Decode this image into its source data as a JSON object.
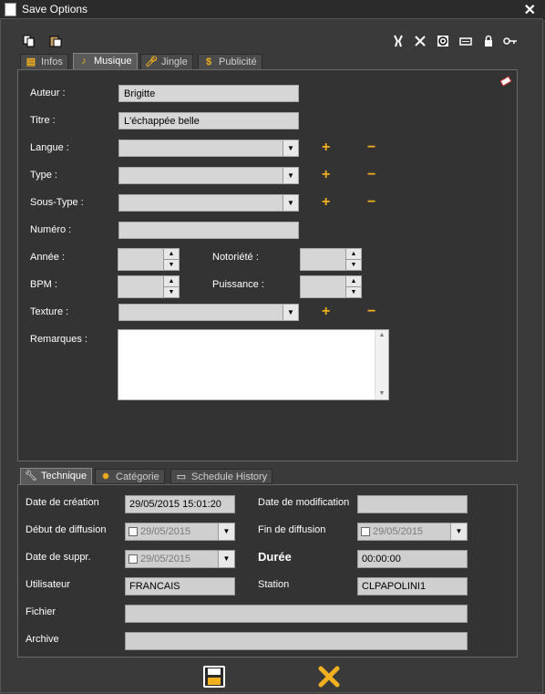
{
  "window": {
    "title": "Save Options"
  },
  "toolbar": {
    "left_icons": [
      "copy-icon",
      "paste-icon"
    ],
    "right_icons": [
      "pliers-icon",
      "tools-icon",
      "target-icon",
      "card-icon",
      "lock-icon",
      "key-icon"
    ]
  },
  "top_tabs": [
    {
      "label": "Infos",
      "icon": "notepad-icon",
      "active": false
    },
    {
      "label": "Musique",
      "icon": "music-note-icon",
      "active": true
    },
    {
      "label": "Jingle",
      "icon": "microphone-icon",
      "active": false
    },
    {
      "label": "Publicité",
      "icon": "dollar-icon",
      "active": false
    }
  ],
  "musique": {
    "auteur_label": "Auteur :",
    "auteur_value": "Brigitte",
    "titre_label": "Titre :",
    "titre_value": "L'échappée belle",
    "langue_label": "Langue :",
    "type_label": "Type :",
    "soustype_label": "Sous-Type :",
    "numero_label": "Numéro :",
    "annee_label": "Année :",
    "notoriete_label": "Notoriété :",
    "bpm_label": "BPM :",
    "puissance_label": "Puissance :",
    "texture_label": "Texture :",
    "remarques_label": "Remarques :"
  },
  "bottom_tabs": [
    {
      "label": "Technique",
      "icon": "wrench-icon",
      "active": true
    },
    {
      "label": "Catégorie",
      "icon": "gear-sun-icon",
      "active": false
    },
    {
      "label": "Schedule History",
      "icon": "monitor-icon",
      "active": false
    }
  ],
  "technique": {
    "date_creation_label": "Date de création",
    "date_creation_value": "29/05/2015 15:01:20",
    "date_modif_label": "Date de modification",
    "date_modif_value": "",
    "debut_label": "Début de diffusion",
    "debut_value": "29/05/2015",
    "fin_label": "Fin de diffusion",
    "fin_value": "29/05/2015",
    "suppr_label": "Date de suppr.",
    "suppr_value": "29/05/2015",
    "duree_label": "Durée",
    "duree_value": "00:00:00",
    "utilisateur_label": "Utilisateur",
    "utilisateur_value": "FRANCAIS",
    "station_label": "Station",
    "station_value": "CLPAPOLINI1",
    "fichier_label": "Fichier",
    "fichier_value": "",
    "archive_label": "Archive",
    "archive_value": ""
  },
  "footer": {
    "save_icon": "floppy-disk-icon",
    "cancel_icon": "cancel-x-icon"
  },
  "colors": {
    "accent": "#f2b01e",
    "panel_bg": "#333333",
    "window_bg": "#3a3a3a"
  }
}
